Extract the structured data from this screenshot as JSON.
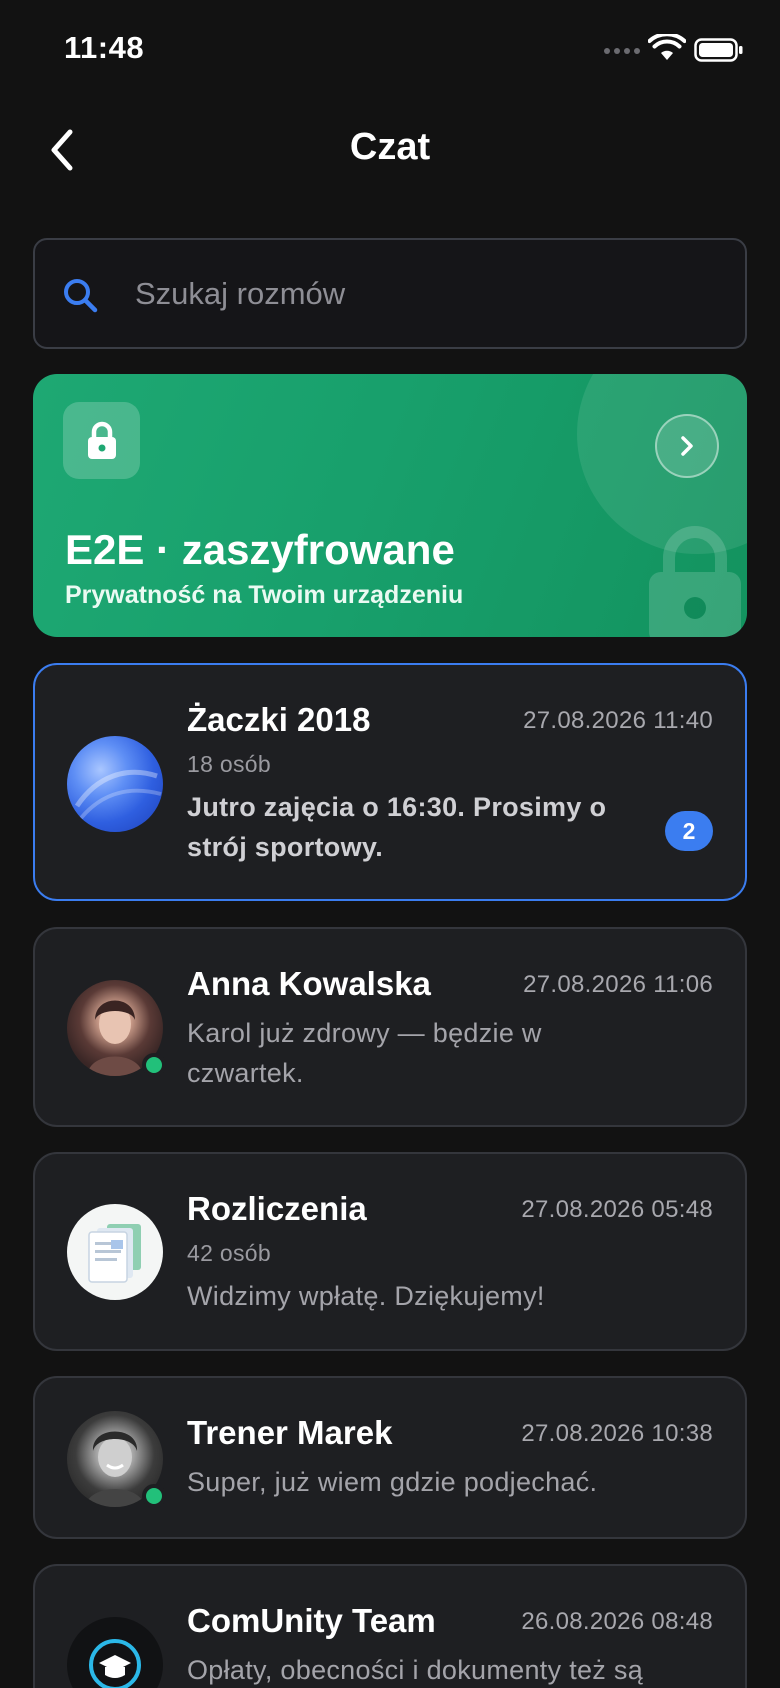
{
  "status_bar": {
    "time": "11:48"
  },
  "nav": {
    "title": "Czat"
  },
  "search": {
    "placeholder": "Szukaj rozmów"
  },
  "banner": {
    "title": "E2E · zaszyfrowane",
    "subtitle": "Prywatność na Twoim urządzeniu"
  },
  "chats": [
    {
      "name": "Żaczki 2018",
      "time": "27.08.2026 11:40",
      "members": "18 osób",
      "preview": "Jutro zajęcia o 16:30. Prosimy o strój sportowy.",
      "unread": "2"
    },
    {
      "name": "Anna Kowalska",
      "time": "27.08.2026 11:06",
      "preview": "Karol już zdrowy — będzie w czwartek."
    },
    {
      "name": "Rozliczenia",
      "time": "27.08.2026 05:48",
      "members": "42 osób",
      "preview": "Widzimy wpłatę. Dziękujemy!"
    },
    {
      "name": "Trener Marek",
      "time": "27.08.2026 10:38",
      "preview": "Super, już wiem gdzie podjechać."
    },
    {
      "name": "ComUnity Team",
      "time": "26.08.2026 08:48",
      "preview": "Opłaty, obecności i dokumenty też są"
    }
  ],
  "colors": {
    "accent": "#3b7df0",
    "banner_green": "#1ea873",
    "online": "#22c07a",
    "background": "#121212"
  }
}
